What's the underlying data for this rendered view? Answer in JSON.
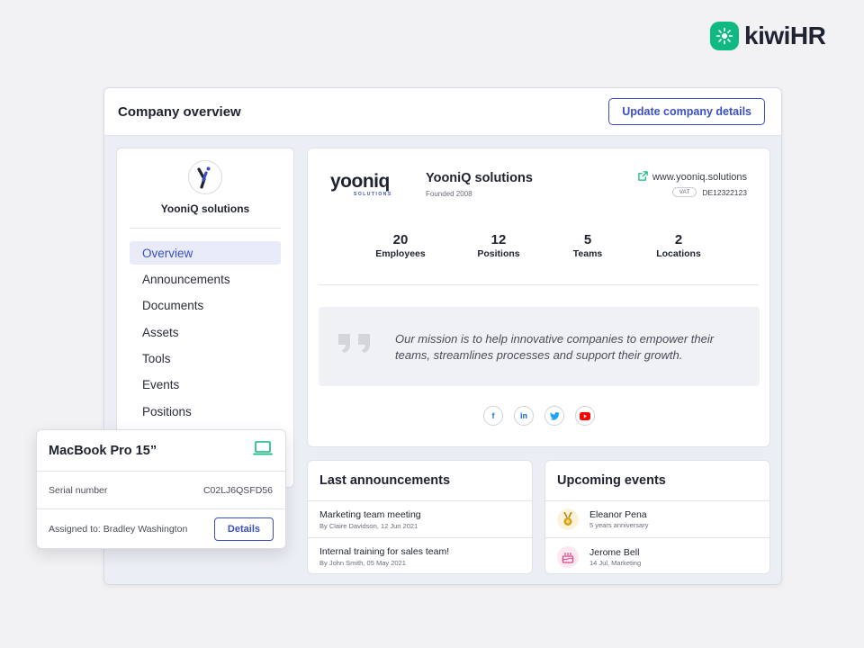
{
  "brand": {
    "name": "kiwiHR",
    "icon": "kiwi-slice-icon",
    "color": "#10b981"
  },
  "header": {
    "title": "Company overview",
    "update_button": "Update company details"
  },
  "sidebar": {
    "company_name": "YooniQ solutions",
    "items": [
      {
        "label": "Overview",
        "active": true
      },
      {
        "label": "Announcements"
      },
      {
        "label": "Documents"
      },
      {
        "label": "Assets"
      },
      {
        "label": "Tools"
      },
      {
        "label": "Events"
      },
      {
        "label": "Positions"
      }
    ]
  },
  "company": {
    "logo_text": "yooniq",
    "logo_sub": "SOLUTIONS",
    "name": "YooniQ solutions",
    "founded": "Founded 2008",
    "website": "www.yooniq.solutions",
    "vat_label": "VAT",
    "vat_number": "DE12322123",
    "stats": [
      {
        "value": "20",
        "label": "Employees"
      },
      {
        "value": "12",
        "label": "Positions"
      },
      {
        "value": "5",
        "label": "Teams"
      },
      {
        "value": "2",
        "label": "Locations"
      }
    ],
    "mission": "Our mission is to help innovative companies to empower their teams, streamlines processes and support their growth.",
    "socials": [
      {
        "icon": "facebook-icon",
        "glyph": "f",
        "color": "#1877f2"
      },
      {
        "icon": "linkedin-icon",
        "glyph": "in",
        "color": "#0a66c2"
      },
      {
        "icon": "twitter-icon",
        "glyph": "t",
        "color": "#1da1f2"
      },
      {
        "icon": "youtube-icon",
        "glyph": "▶",
        "color": "#ff0000"
      }
    ]
  },
  "announcements": {
    "title": "Last announcements",
    "items": [
      {
        "title": "Marketing team meeting",
        "meta": "By Claire Davidson, 12 Jun 2021"
      },
      {
        "title": "Internal training for sales team!",
        "meta": "By John Smith, 05 May 2021"
      }
    ]
  },
  "events": {
    "title": "Upcoming events",
    "items": [
      {
        "name": "Eleanor Pena",
        "meta": "5 years anniversary",
        "icon": "medal-icon"
      },
      {
        "name": "Jerome Bell",
        "meta": "14 Jul, Marketing",
        "icon": "birthday-cake-icon"
      }
    ]
  },
  "asset": {
    "title": "MacBook Pro 15”",
    "icon": "laptop-icon",
    "serial_label": "Serial number",
    "serial_value": "C02LJ6QSFD56",
    "assigned": "Assigned to: Bradley Washington",
    "details_button": "Details"
  }
}
